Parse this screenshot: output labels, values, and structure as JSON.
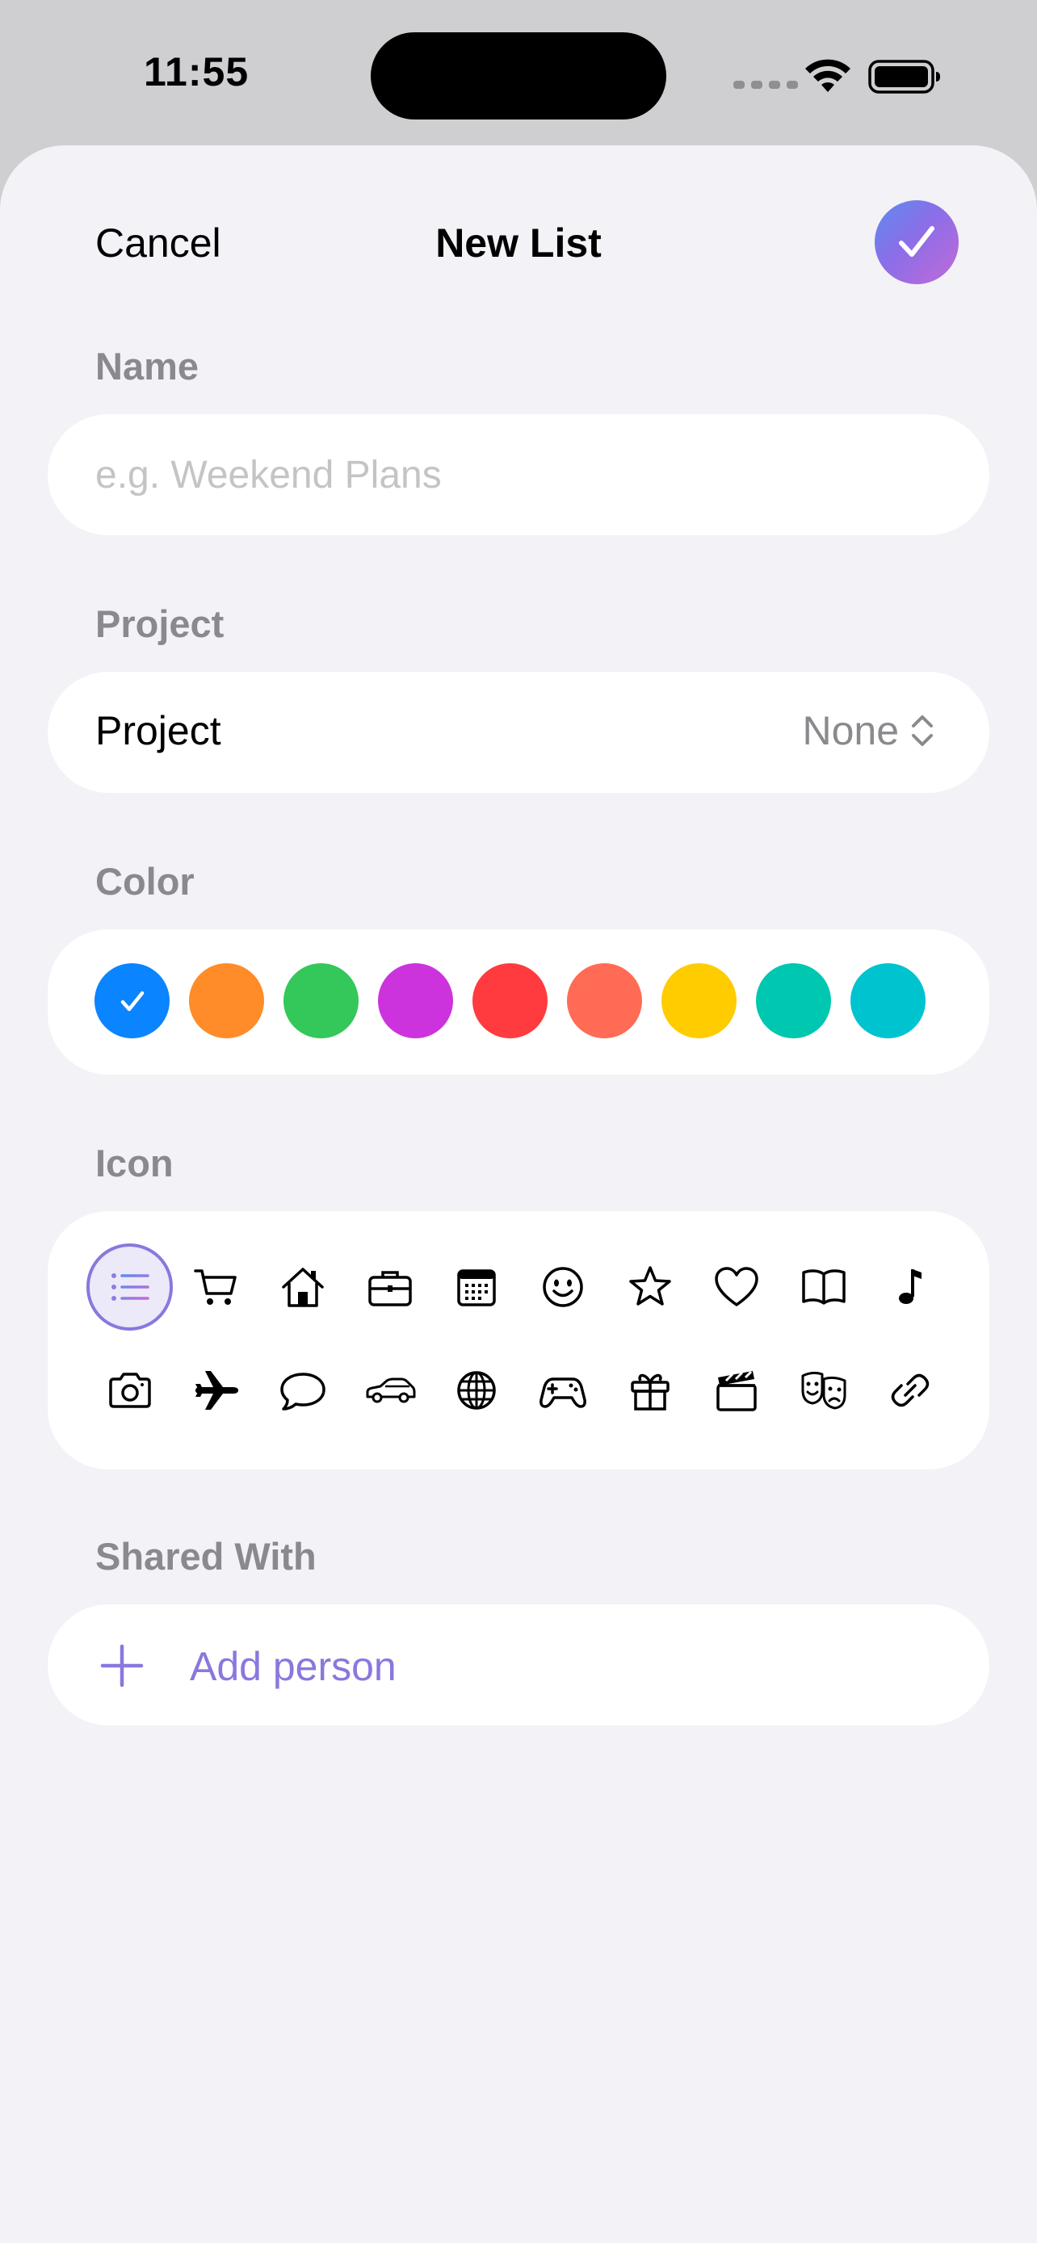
{
  "status_bar": {
    "time": "11:55",
    "wifi_icon": "wifi-icon",
    "battery_icon": "battery-icon"
  },
  "nav": {
    "cancel_label": "Cancel",
    "title": "New List",
    "done_icon": "checkmark-icon"
  },
  "name_section": {
    "label": "Name",
    "value": "",
    "placeholder": "e.g. Weekend Plans"
  },
  "project_section": {
    "label": "Project",
    "row_label": "Project",
    "value": "None",
    "chevron_icon": "chevron-up-down-icon"
  },
  "color_section": {
    "label": "Color",
    "selected_index": 0,
    "colors": [
      "#0a84ff",
      "#ff8c28",
      "#34c759",
      "#cc33dd",
      "#ff3b3f",
      "#ff6b55",
      "#ffcc00",
      "#00c7b0",
      "#00c3d0"
    ]
  },
  "icon_section": {
    "label": "Icon",
    "selected_index": 0,
    "accent": "#8b77dd",
    "icons": [
      "list-icon",
      "cart-icon",
      "house-icon",
      "briefcase-icon",
      "calendar-icon",
      "smiley-icon",
      "star-icon",
      "heart-icon",
      "book-icon",
      "music-note-icon",
      "camera-icon",
      "airplane-icon",
      "speech-bubble-icon",
      "car-icon",
      "globe-icon",
      "gamecontroller-icon",
      "gift-icon",
      "clapperboard-icon",
      "theater-masks-icon",
      "link-icon"
    ]
  },
  "shared_section": {
    "label": "Shared With",
    "add_label": "Add person",
    "add_icon": "plus-icon"
  }
}
